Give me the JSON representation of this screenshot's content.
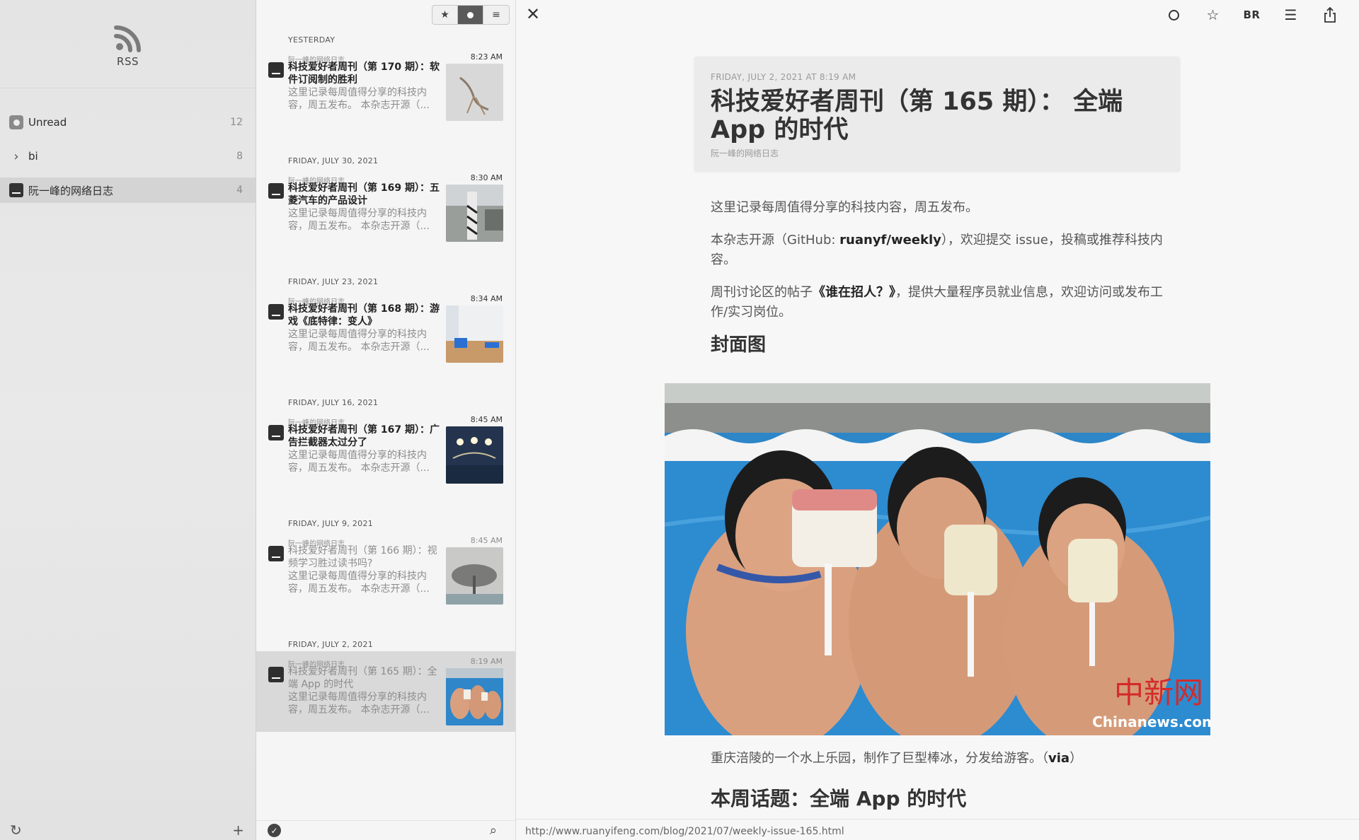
{
  "sidebar": {
    "app_name": "RSS",
    "feeds": [
      {
        "label": "Unread",
        "count": "12"
      },
      {
        "label": "bi",
        "count": "8"
      },
      {
        "label": "阮一峰的网络日志",
        "count": "4"
      }
    ]
  },
  "list": {
    "groups": [
      {
        "date": "YESTERDAY",
        "source": "阮一峰的网络日志",
        "time": "8:23 AM",
        "title": "科技爱好者周刊（第 170 期）：软件订阅制的胜利",
        "summary": "这里记录每周值得分享的科技内容，周五发布。 本杂志开源（..."
      },
      {
        "date": "FRIDAY, JULY 30, 2021",
        "source": "阮一峰的网络日志",
        "time": "8:30 AM",
        "title": "科技爱好者周刊（第 169 期）：五菱汽车的产品设计",
        "summary": "这里记录每周值得分享的科技内容，周五发布。 本杂志开源（..."
      },
      {
        "date": "FRIDAY, JULY 23, 2021",
        "source": "阮一峰的网络日志",
        "time": "8:34 AM",
        "title": "科技爱好者周刊（第 168 期）：游戏《底特律：变人》",
        "summary": "这里记录每周值得分享的科技内容，周五发布。 本杂志开源（..."
      },
      {
        "date": "FRIDAY, JULY 16, 2021",
        "source": "阮一峰的网络日志",
        "time": "8:45 AM",
        "title": "科技爱好者周刊（第 167 期）：广告拦截器太过分了",
        "summary": "这里记录每周值得分享的科技内容，周五发布。 本杂志开源（..."
      },
      {
        "date": "FRIDAY, JULY 9, 2021",
        "source": "阮一峰的网络日志",
        "time": "8:45 AM",
        "title": "科技爱好者周刊（第 166 期）：视频学习胜过读书吗?",
        "summary": "这里记录每周值得分享的科技内容，周五发布。 本杂志开源（..."
      },
      {
        "date": "FRIDAY, JULY 2, 2021",
        "source": "阮一峰的网络日志",
        "time": "8:19 AM",
        "title": "科技爱好者周刊（第 165 期）：全端 App 的时代",
        "summary": "这里记录每周值得分享的科技内容，周五发布。 本杂志开源（..."
      }
    ]
  },
  "reader": {
    "toolbar": {
      "br_label": "BR"
    },
    "date": "FRIDAY, JULY 2, 2021 AT 8:19 AM",
    "title": "科技爱好者周刊（第 165 期）： 全端 App 的时代",
    "source": "阮一峰的网络日志",
    "p1": "这里记录每周值得分享的科技内容，周五发布。",
    "p2_pre": "本杂志开源（GitHub: ",
    "p2_link": "ruanyf/weekly",
    "p2_post": "），欢迎提交 issue，投稿或推荐科技内容。",
    "p3_pre": "周刊讨论区的帖子",
    "p3_link": "《谁在招人？》",
    "p3_post": "，提供大量程序员就业信息，欢迎访问或发布工作/实习岗位。",
    "h_cover": "封面图",
    "watermark_cn": "中新网",
    "watermark_en": "Chinanews.com",
    "caption_pre": "重庆涪陵的一个水上乐园，制作了巨型棒冰，分发给游客。（",
    "caption_link": "via",
    "caption_post": "）",
    "h_topic": "本周话题：全端 App 的时代",
    "status_url": "http://www.ruanyifeng.com/blog/2021/07/weekly-issue-165.html"
  }
}
